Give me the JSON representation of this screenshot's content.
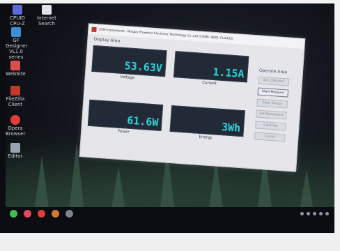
{
  "desktop": {
    "icons": [
      {
        "label": "CPUID CPU-Z"
      },
      {
        "label": "Internet Search"
      },
      {
        "label": "GF Designer VL1.0 series"
      },
      {
        "label": "WebSite"
      },
      {
        "label": "FileZilla Client"
      },
      {
        "label": "Opera Browser"
      },
      {
        "label": "Editor"
      }
    ]
  },
  "window": {
    "title": "COM Instruments - Ningbo Prowehar Electronic Technology Co.,Ltd (COM8, 9600, FU14U2)",
    "display_area_label": "Display Area",
    "operate_area_label": "Operate Area",
    "displays": {
      "voltage": {
        "value": "53.63V",
        "label": "Voltage"
      },
      "current": {
        "value": "1.15A",
        "label": "Current"
      },
      "power": {
        "value": "61.6W",
        "label": "Power"
      },
      "energy": {
        "value": "3Wh",
        "label": "Energy"
      }
    },
    "buttons": [
      {
        "label": "Set COM Port",
        "active": false
      },
      {
        "label": "Start Measure",
        "active": true
      },
      {
        "label": "Clear Energy",
        "active": false
      },
      {
        "label": "Set Parameters",
        "active": false
      },
      {
        "label": "Calibrate",
        "active": false
      },
      {
        "label": "Cancel",
        "active": false
      }
    ]
  }
}
